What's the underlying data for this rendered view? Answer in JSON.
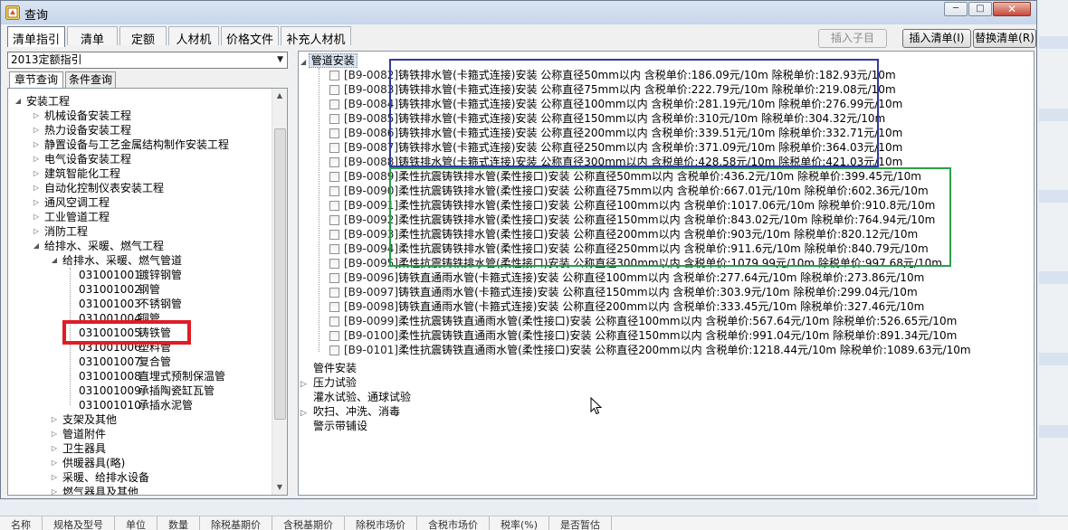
{
  "window": {
    "title": "查询",
    "min_label": "─",
    "max_label": "□",
    "close_label": "✕"
  },
  "tabs": [
    {
      "label": "清单指引",
      "active": true
    },
    {
      "label": "清单"
    },
    {
      "label": "定额"
    },
    {
      "label": "人材机"
    },
    {
      "label": "价格文件"
    },
    {
      "label": "补充人材机"
    }
  ],
  "actions": {
    "insert_child": "插入子目",
    "insert_list": "插入清单(I)",
    "replace_list": "替换清单(R)"
  },
  "left": {
    "dropdown_value": "2013定额指引",
    "subtabs": [
      "章节查询",
      "条件查询"
    ],
    "tree": [
      {
        "label": "安装工程",
        "level": 0,
        "state": "open"
      },
      {
        "label": "机械设备安装工程",
        "level": 1,
        "state": "closed"
      },
      {
        "label": "热力设备安装工程",
        "level": 1,
        "state": "closed"
      },
      {
        "label": "静置设备与工艺金属结构制作安装工程",
        "level": 1,
        "state": "closed"
      },
      {
        "label": "电气设备安装工程",
        "level": 1,
        "state": "closed"
      },
      {
        "label": "建筑智能化工程",
        "level": 1,
        "state": "closed"
      },
      {
        "label": "自动化控制仪表安装工程",
        "level": 1,
        "state": "closed"
      },
      {
        "label": "通风空调工程",
        "level": 1,
        "state": "closed"
      },
      {
        "label": "工业管道工程",
        "level": 1,
        "state": "closed"
      },
      {
        "label": "消防工程",
        "level": 1,
        "state": "closed"
      },
      {
        "label": "给排水、采暖、燃气工程",
        "level": 1,
        "state": "open"
      },
      {
        "label": "给排水、采暖、燃气管道",
        "level": 2,
        "state": "open"
      },
      {
        "code": "031001001",
        "label": "镀锌钢管",
        "level": 3
      },
      {
        "code": "031001002",
        "label": "钢管",
        "level": 3
      },
      {
        "code": "031001003",
        "label": "不锈钢管",
        "level": 3
      },
      {
        "code": "031001004",
        "label": "铜管",
        "level": 3
      },
      {
        "code": "031001005",
        "label": "铸铁管",
        "level": 3,
        "selected": true
      },
      {
        "code": "031001006",
        "label": "塑料管",
        "level": 3
      },
      {
        "code": "031001007",
        "label": "复合管",
        "level": 3
      },
      {
        "code": "031001008",
        "label": "直埋式预制保温管",
        "level": 3
      },
      {
        "code": "031001009",
        "label": "承插陶瓷缸瓦管",
        "level": 3
      },
      {
        "code": "031001010",
        "label": "承插水泥管",
        "level": 3
      },
      {
        "label": "支架及其他",
        "level": 2,
        "state": "closed"
      },
      {
        "label": "管道附件",
        "level": 2,
        "state": "closed"
      },
      {
        "label": "卫生器具",
        "level": 2,
        "state": "closed"
      },
      {
        "label": "供暖器具(略)",
        "level": 2,
        "state": "closed"
      },
      {
        "label": "采暖、给排水设备",
        "level": 2,
        "state": "closed"
      },
      {
        "label": "燃气器具及其他",
        "level": 2,
        "state": "closed"
      },
      {
        "label": "医疗气体设备及附件",
        "level": 2,
        "state": "closed"
      }
    ]
  },
  "right": {
    "group": "管道安装",
    "items": [
      {
        "code": "[B9-0082]",
        "text": "铸铁排水管(卡箍式连接)安装 公称直径50mm以内 含税单价:186.09元/10m 除税单价:182.93元/10m"
      },
      {
        "code": "[B9-0083]",
        "text": "铸铁排水管(卡箍式连接)安装 公称直径75mm以内 含税单价:222.79元/10m 除税单价:219.08元/10m"
      },
      {
        "code": "[B9-0084]",
        "text": "铸铁排水管(卡箍式连接)安装 公称直径100mm以内 含税单价:281.19元/10m 除税单价:276.99元/10m"
      },
      {
        "code": "[B9-0085]",
        "text": "铸铁排水管(卡箍式连接)安装 公称直径150mm以内 含税单价:310元/10m 除税单价:304.32元/10m"
      },
      {
        "code": "[B9-0086]",
        "text": "铸铁排水管(卡箍式连接)安装 公称直径200mm以内 含税单价:339.51元/10m 除税单价:332.71元/10m"
      },
      {
        "code": "[B9-0087]",
        "text": "铸铁排水管(卡箍式连接)安装 公称直径250mm以内 含税单价:371.09元/10m 除税单价:364.03元/10m"
      },
      {
        "code": "[B9-0088]",
        "text": "铸铁排水管(卡箍式连接)安装 公称直径300mm以内 含税单价:428.58元/10m 除税单价:421.03元/10m"
      },
      {
        "code": "[B9-0089]",
        "text": "柔性抗震铸铁排水管(柔性接口)安装 公称直径50mm以内 含税单价:436.2元/10m 除税单价:399.45元/10m"
      },
      {
        "code": "[B9-0090]",
        "text": "柔性抗震铸铁排水管(柔性接口)安装 公称直径75mm以内 含税单价:667.01元/10m 除税单价:602.36元/10m"
      },
      {
        "code": "[B9-0091]",
        "text": "柔性抗震铸铁排水管(柔性接口)安装 公称直径100mm以内 含税单价:1017.06元/10m 除税单价:910.8元/10m"
      },
      {
        "code": "[B9-0092]",
        "text": "柔性抗震铸铁排水管(柔性接口)安装 公称直径150mm以内 含税单价:843.02元/10m 除税单价:764.94元/10m"
      },
      {
        "code": "[B9-0093]",
        "text": "柔性抗震铸铁排水管(柔性接口)安装 公称直径200mm以内 含税单价:903元/10m 除税单价:820.12元/10m"
      },
      {
        "code": "[B9-0094]",
        "text": "柔性抗震铸铁排水管(柔性接口)安装 公称直径250mm以内 含税单价:911.6元/10m 除税单价:840.79元/10m"
      },
      {
        "code": "[B9-0095]",
        "text": "柔性抗震铸铁排水管(柔性接口)安装 公称直径300mm以内 含税单价:1079.99元/10m 除税单价:997.68元/10m"
      },
      {
        "code": "[B9-0096]",
        "text": "铸铁直通雨水管(卡箍式连接)安装 公称直径100mm以内 含税单价:277.64元/10m 除税单价:273.86元/10m"
      },
      {
        "code": "[B9-0097]",
        "text": "铸铁直通雨水管(卡箍式连接)安装 公称直径150mm以内 含税单价:303.9元/10m 除税单价:299.04元/10m"
      },
      {
        "code": "[B9-0098]",
        "text": "铸铁直通雨水管(卡箍式连接)安装 公称直径200mm以内 含税单价:333.45元/10m 除税单价:327.46元/10m"
      },
      {
        "code": "[B9-0099]",
        "text": "柔性抗震铸铁直通雨水管(柔性接口)安装 公称直径100mm以内 含税单价:567.64元/10m 除税单价:526.65元/10m"
      },
      {
        "code": "[B9-0100]",
        "text": "柔性抗震铸铁直通雨水管(柔性接口)安装 公称直径150mm以内 含税单价:991.04元/10m 除税单价:891.34元/10m"
      },
      {
        "code": "[B9-0101]",
        "text": "柔性抗震铸铁直通雨水管(柔性接口)安装 公称直径200mm以内 含税单价:1218.44元/10m 除税单价:1089.63元/10m"
      }
    ],
    "other_groups": [
      {
        "label": "管件安装",
        "expandable": false
      },
      {
        "label": "压力试验",
        "expandable": true
      },
      {
        "label": "灌水试验、通球试验",
        "expandable": false
      },
      {
        "label": "吹扫、冲洗、消毒",
        "expandable": true
      },
      {
        "label": "警示带铺设",
        "expandable": false
      }
    ]
  },
  "annotation_colors": {
    "blue_box": "#2f3aa8",
    "green_box": "#2aa04a",
    "red_box": "#e01c25"
  },
  "background": {
    "bottom_tabs": [
      "名称",
      "规格及型号",
      "单位",
      "数量",
      "除税基期价",
      "含税基期价",
      "除税市场价",
      "含税市场价",
      "税率(%)",
      "是否暂估"
    ]
  }
}
